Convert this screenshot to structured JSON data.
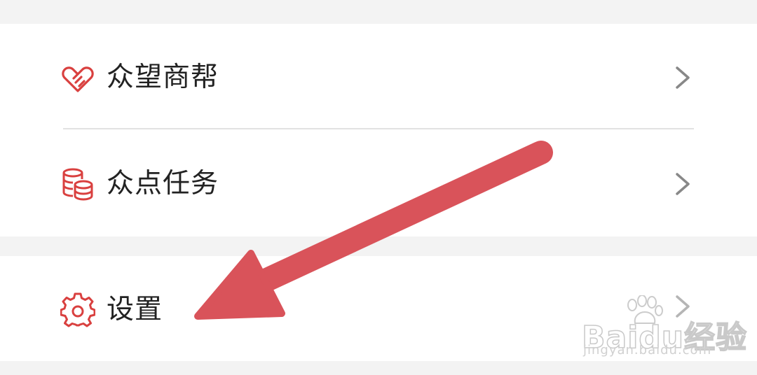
{
  "menu": {
    "items": [
      {
        "label": "众望商帮",
        "icon": "handshake-icon"
      },
      {
        "label": "众点任务",
        "icon": "coins-stack-icon"
      }
    ]
  },
  "settings": {
    "label": "设置",
    "icon": "gear-icon"
  },
  "watermark": {
    "brand": "Baidu经验",
    "url": "jingyan.baidu.com"
  },
  "colors": {
    "icon_red": "#d9403f",
    "arrow_red": "#d9535a",
    "label": "#222222",
    "chevron": "#888888",
    "divider": "#e2e2e2",
    "background": "#f3f3f3",
    "card": "#ffffff"
  }
}
